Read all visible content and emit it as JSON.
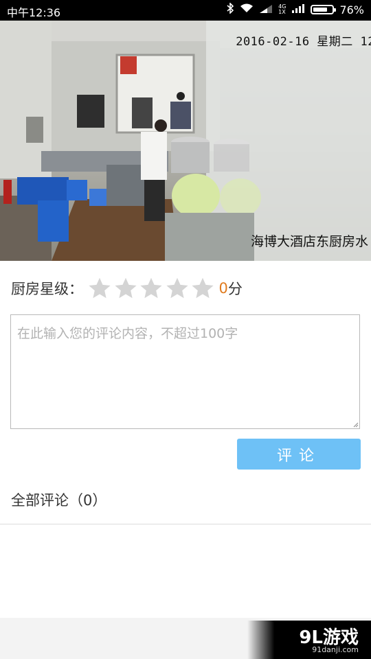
{
  "status_bar": {
    "time": "中午12:36",
    "network_top": "4G",
    "network_bottom": "1X",
    "battery_level": 0.76,
    "battery_text": "76%"
  },
  "camera": {
    "timestamp": "2016-02-16  星期二  12",
    "location_label": "海博大酒店东厨房水"
  },
  "rating": {
    "label": "厨房星级：",
    "max_stars": 5,
    "filled_stars": 0,
    "score": "0",
    "score_unit": "分",
    "star_color": "#d4d4d4",
    "score_color": "#e07b1f"
  },
  "comment": {
    "placeholder": "在此输入您的评论内容，不超过100字",
    "submit_label": "评论",
    "button_color": "#6ec1f6"
  },
  "comments_section": {
    "title": "全部评论（0）"
  },
  "watermark": {
    "logo": "9L游戏",
    "site": "91danji.com"
  }
}
